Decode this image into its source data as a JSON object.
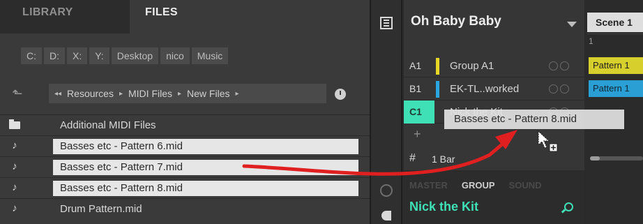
{
  "browser": {
    "tabs": [
      {
        "label": "LIBRARY"
      },
      {
        "label": "FILES"
      }
    ],
    "drives": [
      "C:",
      "D:",
      "X:",
      "Y:",
      "Desktop",
      "nico",
      "Music"
    ],
    "breadcrumb": {
      "start_glyph": "◂◂",
      "items": [
        "Resources",
        "MIDI Files",
        "New Files"
      ],
      "separator": "▸"
    },
    "files": [
      {
        "name": "Additional MIDI Files",
        "type": "folder",
        "selected": false
      },
      {
        "name": "Basses etc - Pattern 6.mid",
        "type": "midi",
        "selected": true
      },
      {
        "name": "Basses etc - Pattern 7.mid",
        "type": "midi",
        "selected": true
      },
      {
        "name": "Basses etc - Pattern 8.mid",
        "type": "midi",
        "selected": true
      },
      {
        "name": "Drum Pattern.mid",
        "type": "midi",
        "selected": false
      }
    ]
  },
  "groups_panel": {
    "song_title": "Oh Baby Baby",
    "groups": [
      {
        "id": "A1",
        "name": "Group A1",
        "color": "#e6d824",
        "selected": false
      },
      {
        "id": "B1",
        "name": "EK-TL..worked",
        "color": "#2aa6e0",
        "selected": false
      },
      {
        "id": "C1",
        "name": "Nick the Kit",
        "color": "#3fe0b5",
        "selected": true
      }
    ],
    "add_label": "+",
    "length_label": "1 Bar",
    "length_icon": "#"
  },
  "info_panel": {
    "tabs": [
      "MASTER",
      "GROUP",
      "SOUND"
    ],
    "active_tab": "GROUP",
    "group_name": "Nick the Kit"
  },
  "scene": {
    "header": "Scene 1",
    "bar_number": "1",
    "patterns": [
      "Pattern 1",
      "Pattern 1"
    ],
    "pattern_colors": [
      "#d7cf2c",
      "#2a9fd4"
    ]
  },
  "drag": {
    "ghost_label": "Basses etc - Pattern 8.mid"
  },
  "colors": {
    "accent": "#3fe0b5",
    "annotation_arrow": "#e02020"
  }
}
